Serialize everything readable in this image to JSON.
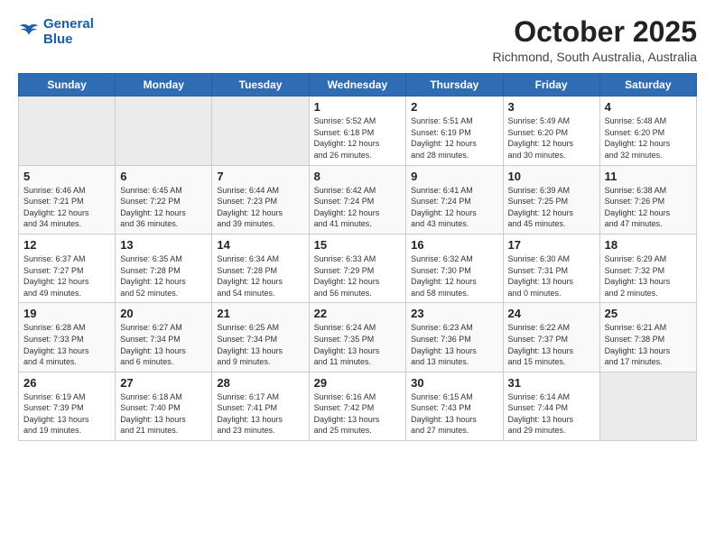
{
  "header": {
    "logo_line1": "General",
    "logo_line2": "Blue",
    "month": "October 2025",
    "location": "Richmond, South Australia, Australia"
  },
  "weekdays": [
    "Sunday",
    "Monday",
    "Tuesday",
    "Wednesday",
    "Thursday",
    "Friday",
    "Saturday"
  ],
  "weeks": [
    [
      {
        "day": "",
        "info": ""
      },
      {
        "day": "",
        "info": ""
      },
      {
        "day": "",
        "info": ""
      },
      {
        "day": "1",
        "info": "Sunrise: 5:52 AM\nSunset: 6:18 PM\nDaylight: 12 hours\nand 26 minutes."
      },
      {
        "day": "2",
        "info": "Sunrise: 5:51 AM\nSunset: 6:19 PM\nDaylight: 12 hours\nand 28 minutes."
      },
      {
        "day": "3",
        "info": "Sunrise: 5:49 AM\nSunset: 6:20 PM\nDaylight: 12 hours\nand 30 minutes."
      },
      {
        "day": "4",
        "info": "Sunrise: 5:48 AM\nSunset: 6:20 PM\nDaylight: 12 hours\nand 32 minutes."
      }
    ],
    [
      {
        "day": "5",
        "info": "Sunrise: 6:46 AM\nSunset: 7:21 PM\nDaylight: 12 hours\nand 34 minutes."
      },
      {
        "day": "6",
        "info": "Sunrise: 6:45 AM\nSunset: 7:22 PM\nDaylight: 12 hours\nand 36 minutes."
      },
      {
        "day": "7",
        "info": "Sunrise: 6:44 AM\nSunset: 7:23 PM\nDaylight: 12 hours\nand 39 minutes."
      },
      {
        "day": "8",
        "info": "Sunrise: 6:42 AM\nSunset: 7:24 PM\nDaylight: 12 hours\nand 41 minutes."
      },
      {
        "day": "9",
        "info": "Sunrise: 6:41 AM\nSunset: 7:24 PM\nDaylight: 12 hours\nand 43 minutes."
      },
      {
        "day": "10",
        "info": "Sunrise: 6:39 AM\nSunset: 7:25 PM\nDaylight: 12 hours\nand 45 minutes."
      },
      {
        "day": "11",
        "info": "Sunrise: 6:38 AM\nSunset: 7:26 PM\nDaylight: 12 hours\nand 47 minutes."
      }
    ],
    [
      {
        "day": "12",
        "info": "Sunrise: 6:37 AM\nSunset: 7:27 PM\nDaylight: 12 hours\nand 49 minutes."
      },
      {
        "day": "13",
        "info": "Sunrise: 6:35 AM\nSunset: 7:28 PM\nDaylight: 12 hours\nand 52 minutes."
      },
      {
        "day": "14",
        "info": "Sunrise: 6:34 AM\nSunset: 7:28 PM\nDaylight: 12 hours\nand 54 minutes."
      },
      {
        "day": "15",
        "info": "Sunrise: 6:33 AM\nSunset: 7:29 PM\nDaylight: 12 hours\nand 56 minutes."
      },
      {
        "day": "16",
        "info": "Sunrise: 6:32 AM\nSunset: 7:30 PM\nDaylight: 12 hours\nand 58 minutes."
      },
      {
        "day": "17",
        "info": "Sunrise: 6:30 AM\nSunset: 7:31 PM\nDaylight: 13 hours\nand 0 minutes."
      },
      {
        "day": "18",
        "info": "Sunrise: 6:29 AM\nSunset: 7:32 PM\nDaylight: 13 hours\nand 2 minutes."
      }
    ],
    [
      {
        "day": "19",
        "info": "Sunrise: 6:28 AM\nSunset: 7:33 PM\nDaylight: 13 hours\nand 4 minutes."
      },
      {
        "day": "20",
        "info": "Sunrise: 6:27 AM\nSunset: 7:34 PM\nDaylight: 13 hours\nand 6 minutes."
      },
      {
        "day": "21",
        "info": "Sunrise: 6:25 AM\nSunset: 7:34 PM\nDaylight: 13 hours\nand 9 minutes."
      },
      {
        "day": "22",
        "info": "Sunrise: 6:24 AM\nSunset: 7:35 PM\nDaylight: 13 hours\nand 11 minutes."
      },
      {
        "day": "23",
        "info": "Sunrise: 6:23 AM\nSunset: 7:36 PM\nDaylight: 13 hours\nand 13 minutes."
      },
      {
        "day": "24",
        "info": "Sunrise: 6:22 AM\nSunset: 7:37 PM\nDaylight: 13 hours\nand 15 minutes."
      },
      {
        "day": "25",
        "info": "Sunrise: 6:21 AM\nSunset: 7:38 PM\nDaylight: 13 hours\nand 17 minutes."
      }
    ],
    [
      {
        "day": "26",
        "info": "Sunrise: 6:19 AM\nSunset: 7:39 PM\nDaylight: 13 hours\nand 19 minutes."
      },
      {
        "day": "27",
        "info": "Sunrise: 6:18 AM\nSunset: 7:40 PM\nDaylight: 13 hours\nand 21 minutes."
      },
      {
        "day": "28",
        "info": "Sunrise: 6:17 AM\nSunset: 7:41 PM\nDaylight: 13 hours\nand 23 minutes."
      },
      {
        "day": "29",
        "info": "Sunrise: 6:16 AM\nSunset: 7:42 PM\nDaylight: 13 hours\nand 25 minutes."
      },
      {
        "day": "30",
        "info": "Sunrise: 6:15 AM\nSunset: 7:43 PM\nDaylight: 13 hours\nand 27 minutes."
      },
      {
        "day": "31",
        "info": "Sunrise: 6:14 AM\nSunset: 7:44 PM\nDaylight: 13 hours\nand 29 minutes."
      },
      {
        "day": "",
        "info": ""
      }
    ]
  ]
}
